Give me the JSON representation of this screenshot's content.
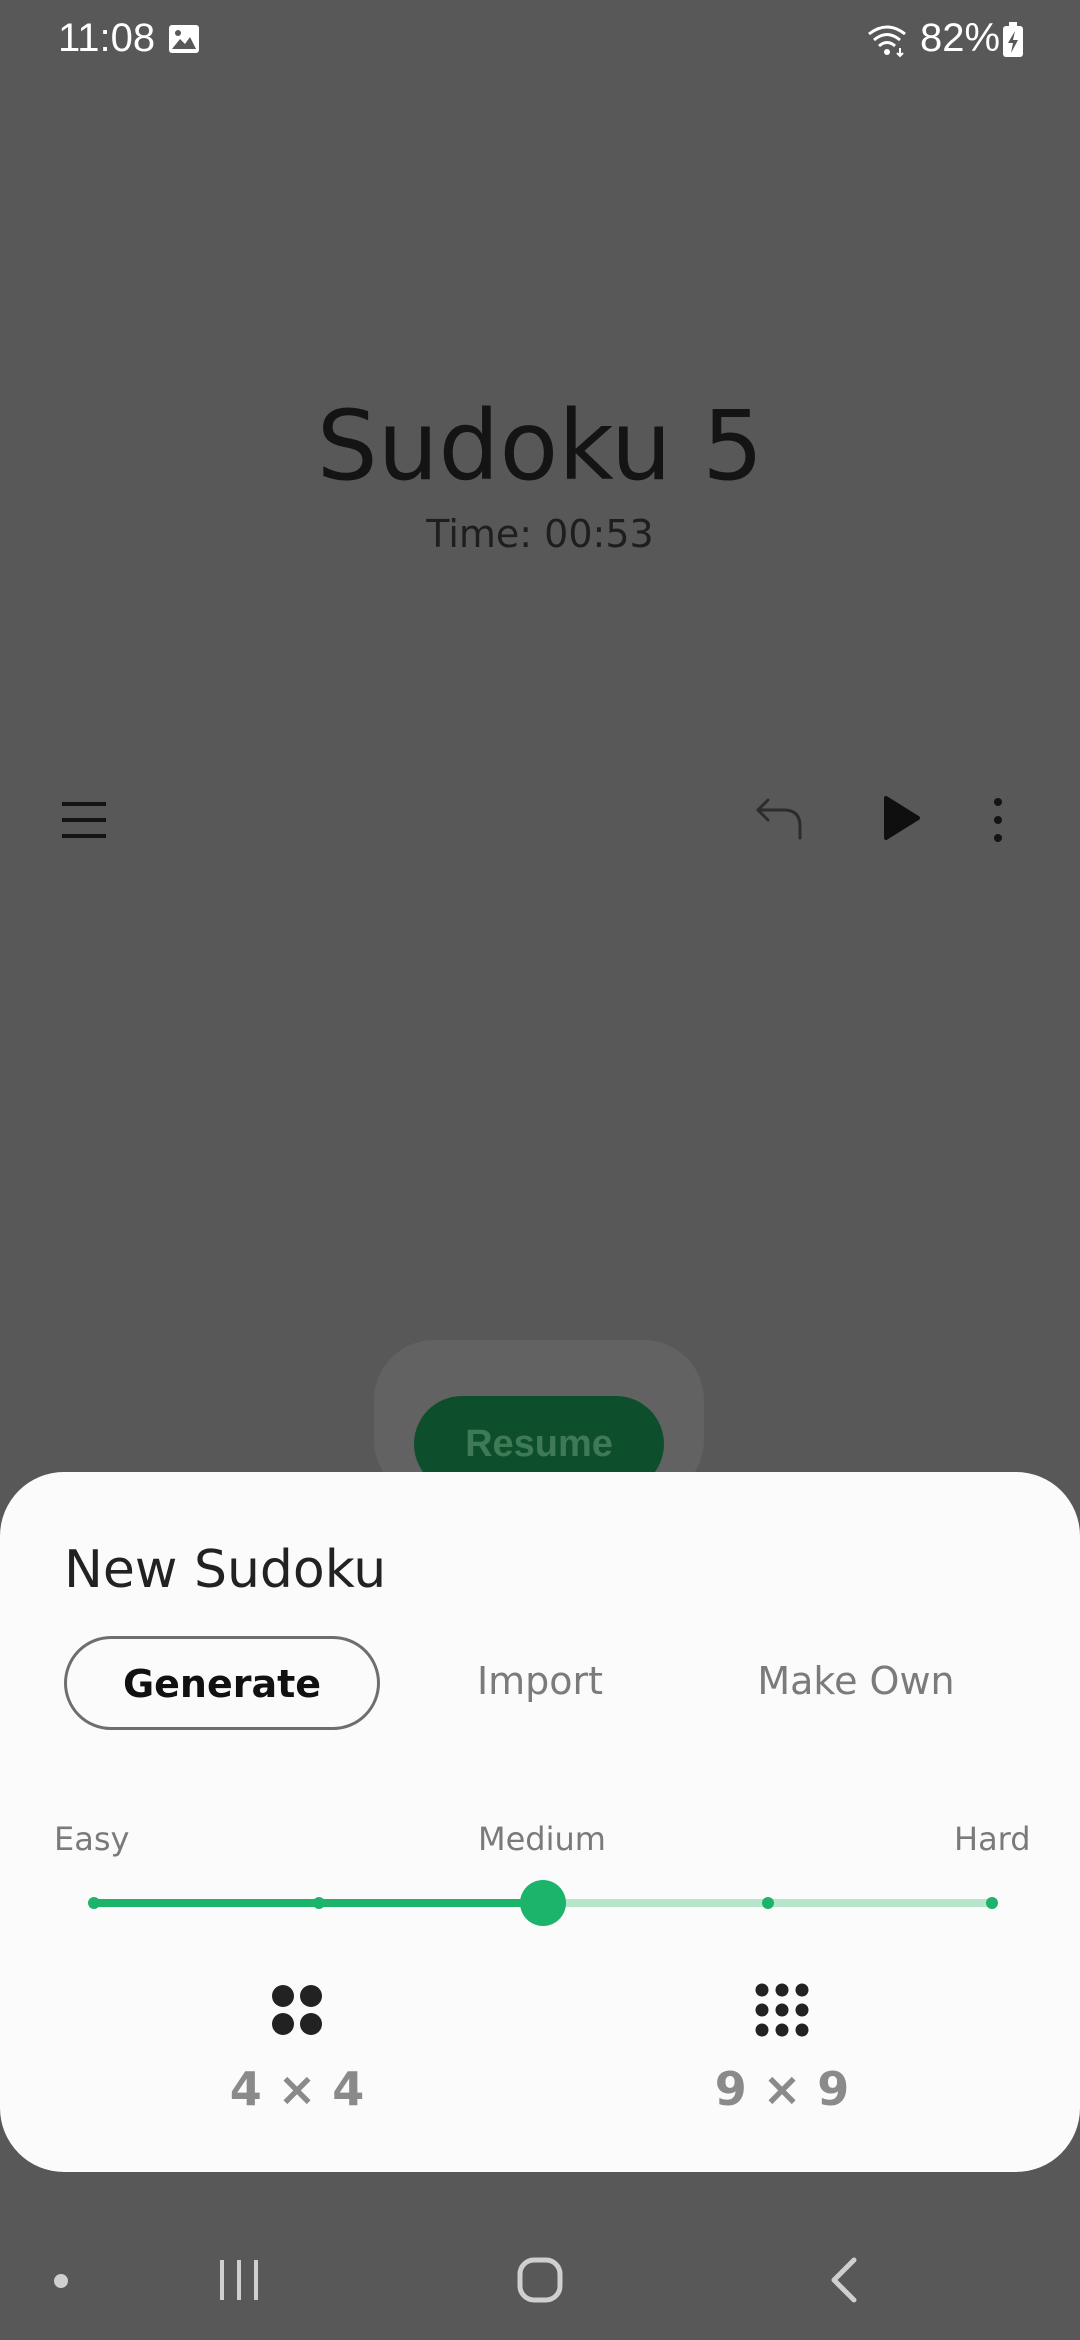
{
  "status_bar": {
    "time": "11:08",
    "battery": "82%",
    "icons": [
      "gallery-icon",
      "wifi-icon",
      "battery-charging-icon"
    ]
  },
  "game": {
    "title": "Sudoku 5",
    "timer": "Time: 00:53",
    "resume_label": "Resume",
    "toolbar_icons": [
      "menu-icon",
      "undo-icon",
      "play-icon",
      "more-icon"
    ]
  },
  "new_sudoku": {
    "title": "New Sudoku",
    "tabs": [
      "Generate",
      "Import",
      "Make Own"
    ],
    "selected_tab": "Generate",
    "difficulty": {
      "labels": {
        "easy": "Easy",
        "medium": "Medium",
        "hard": "Hard"
      },
      "levels": 5,
      "selected_index": 2
    },
    "sizes": [
      {
        "label": "4 × 4",
        "icon": "grid-4-icon"
      },
      {
        "label": "9 × 9",
        "icon": "grid-9-icon"
      }
    ]
  },
  "nav_bar": {
    "icons": [
      "nav-dot",
      "recents-icon",
      "home-icon",
      "back-icon"
    ]
  },
  "colors": {
    "accent": "#1bb46a",
    "accent_light": "#b5e6ca",
    "scrim": "#585858",
    "sheet": "#fbfbfb",
    "resume_button": "#0d4f2c"
  }
}
